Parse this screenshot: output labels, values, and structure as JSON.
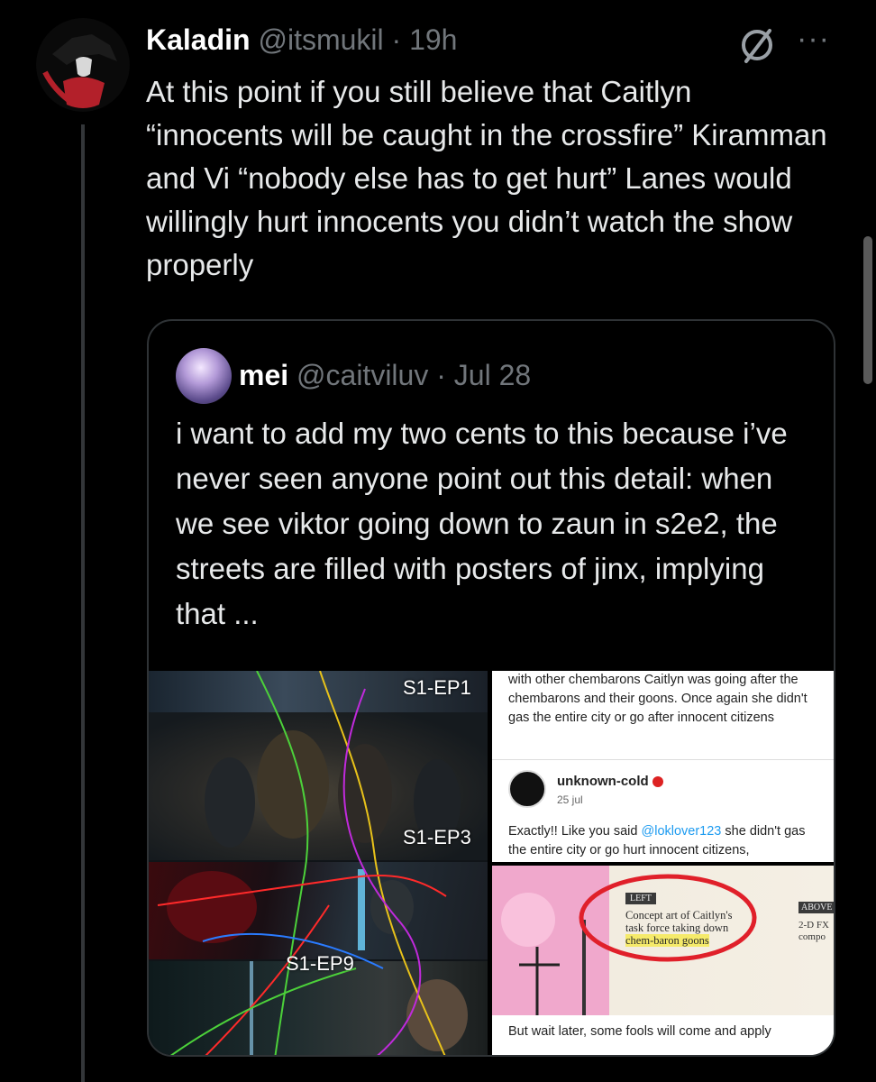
{
  "tweet": {
    "display_name": "Kaladin",
    "handle": "@itsmukil",
    "separator": "·",
    "time": "19h",
    "text": "At this point if you still believe that Caitlyn “innocents will be caught in the crossfire” Kiramman and Vi “nobody else has to get hurt” Lanes would willingly hurt innocents you didn’t watch the show properly",
    "grok_icon": "grok-icon",
    "more_icon_glyph": "···"
  },
  "quote": {
    "display_name": "mei",
    "handle": "@caitviluv",
    "separator": "·",
    "date": "Jul 28",
    "text": "i want to add my two cents to this because i’ve never seen anyone point out this detail: when we see viktor going down to zaun in s2e2, the streets are filled with posters of jinx, implying that ..."
  },
  "media": {
    "left_labels": [
      "S1-EP1",
      "S1-EP3",
      "S1-EP9"
    ],
    "right_top": {
      "post_text": "with other chembarons Caitlyn was going after the chembarons and their goons. Once again she didn't gas the entire city or go after innocent citizens",
      "username": "unknown-cold",
      "date": "25 jul",
      "reply_prefix": "Exactly!! Like you said ",
      "reply_mention": "@loklover123",
      "reply_suffix": " she didn't gas the entire city or go hurt innocent citizens,"
    },
    "right_bottom": {
      "tag_left": "LEFT",
      "caption_line1": "Concept art of Caitlyn's",
      "caption_line2": "task force taking down",
      "caption_line3": "chem-baron goons",
      "tag_above": "ABOVE",
      "side_line1": "2-D FX",
      "side_line2": "compo",
      "bottom_text": "But wait later, some fools will come and apply"
    }
  },
  "colors": {
    "background": "#000000",
    "text": "#e7e9ea",
    "muted": "#71767b",
    "border": "#2f3336",
    "highlight_circle": "#e0202a",
    "mention": "#1d9bf0"
  }
}
